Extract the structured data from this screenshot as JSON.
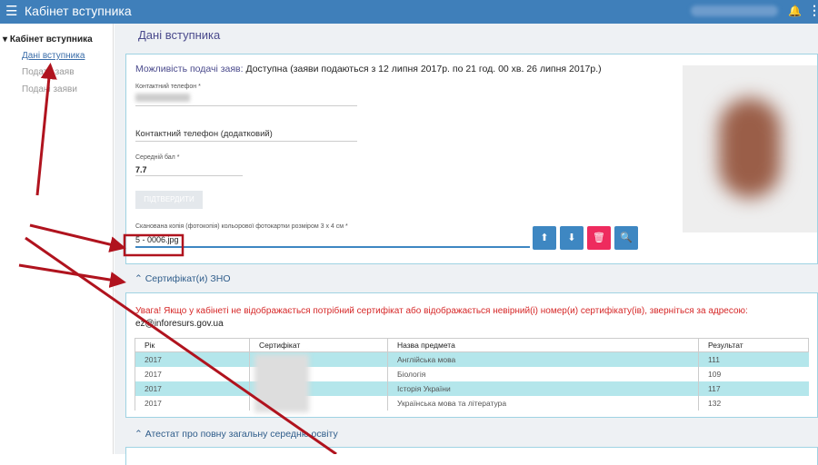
{
  "header": {
    "title": "Кабінет вступника"
  },
  "sidebar": {
    "heading": "Кабінет вступника",
    "items": [
      {
        "label": "Дані вступника"
      },
      {
        "label": "Подати заяв"
      },
      {
        "label": "Подані заяви"
      }
    ]
  },
  "main": {
    "title": "Дані вступника",
    "availability_label": "Можливість подачі заяв:",
    "availability_value": "Доступна (заяви подаються з 12 липня 2017р. по 21 год. 00 хв. 26 липня 2017р.)",
    "phone_label": "Контактний телефон *",
    "phone2_label": "Контактний телефон (додатковий)",
    "avg_label": "Середній бал *",
    "avg_value": "7.7",
    "confirm_label": "ПІДТВЕРДИТИ",
    "photo_field_label": "Сканована копія (фотокопія) кольорової фотокартки розміром 3 х 4 см *",
    "photo_field_value": "5 - 0006.jpg"
  },
  "zno": {
    "title": "Сертифікат(и) ЗНО",
    "warning": "Увага! Якщо у кабінеті не відображається потрібний сертифікат або відображається невірний(і) номер(и) сертифікату(ів), зверніться за адресою:",
    "email": "ez@inforesurs.gov.ua",
    "columns": [
      "Рік",
      "Сертифікат",
      "Назва предмета",
      "Результат"
    ],
    "rows": [
      {
        "year": "2017",
        "cert": "",
        "subject": "Англійська мова",
        "result": "111"
      },
      {
        "year": "2017",
        "cert": "",
        "subject": "Біологія",
        "result": "109"
      },
      {
        "year": "2017",
        "cert": "",
        "subject": "Історія України",
        "result": "117"
      },
      {
        "year": "2017",
        "cert": "",
        "subject": "Українська мова та література",
        "result": "132"
      }
    ]
  },
  "attestat": {
    "title": "Атестат про повну загальну середню освіту"
  },
  "colors": {
    "topbar": "#3f7fba",
    "upload": "#3e87c2",
    "delete": "#ee2b5e",
    "highlight": "#b4e6eb",
    "annotation": "#b0131e"
  }
}
